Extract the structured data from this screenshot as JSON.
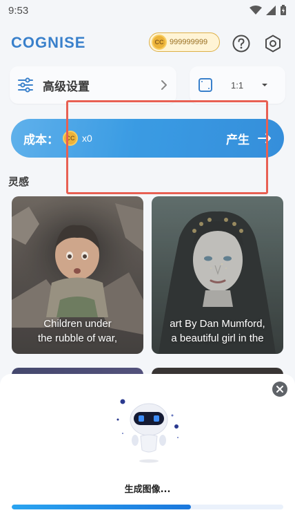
{
  "status_bar": {
    "time": "9:53"
  },
  "header": {
    "logo": "COGNISE",
    "coin_badge": "CC",
    "coin_balance": "999999999",
    "help_icon": "question-circle-icon",
    "settings_icon": "hexagon-gear-icon"
  },
  "controls": {
    "advanced_settings_label": "高级设置",
    "aspect_ratio": "1:1"
  },
  "cost_bar": {
    "cost_label": "成本：",
    "coin_badge": "CC",
    "cost_amount": "x0",
    "generate_label": "产生"
  },
  "inspiration": {
    "title": "灵感",
    "cards": [
      {
        "caption_line1": "Children under",
        "caption_line2": "the rubble of war,"
      },
      {
        "caption_line1": "art By Dan Mumford,",
        "caption_line2": "a beautiful girl in the"
      }
    ]
  },
  "sheet": {
    "status_text": "生成图像...",
    "progress": 0.66
  },
  "colors": {
    "brand_blue": "#1e6fc4",
    "accent_gradient_start": "#4aa6e8",
    "accent_gradient_end": "#1a7fd6",
    "coin_gold": "#e9a81e",
    "highlight_red": "#e54b3c"
  }
}
